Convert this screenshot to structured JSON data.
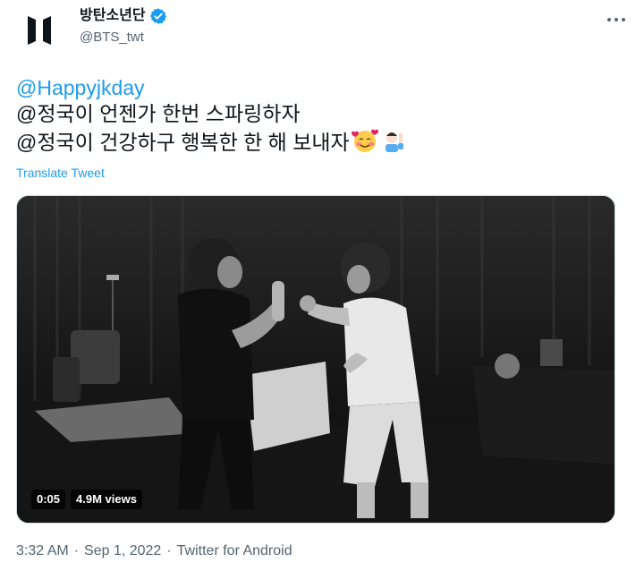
{
  "author": {
    "display_name": "방탄소년단",
    "handle": "@BTS_twt",
    "verified": true,
    "avatar_icon": "bts-logo-icon"
  },
  "tweet": {
    "line1_mention": "@Happyjkday",
    "line2": "@정국이 언젠가 한번 스파링하자",
    "line3": "@정국이 건강하구 행복한 한 해 보내자",
    "line3_emojis": [
      "smiling-face-with-hearts-icon",
      "raising-hand-person-icon"
    ],
    "translate_label": "Translate Tweet"
  },
  "video": {
    "duration": "0:05",
    "views": "4.9M views"
  },
  "meta": {
    "time": "3:32 AM",
    "separator": "·",
    "date": "Sep 1, 2022",
    "source": "Twitter for Android"
  },
  "colors": {
    "accent": "#1d9bf0",
    "secondary_text": "#536471",
    "primary_text": "#0f1419"
  }
}
